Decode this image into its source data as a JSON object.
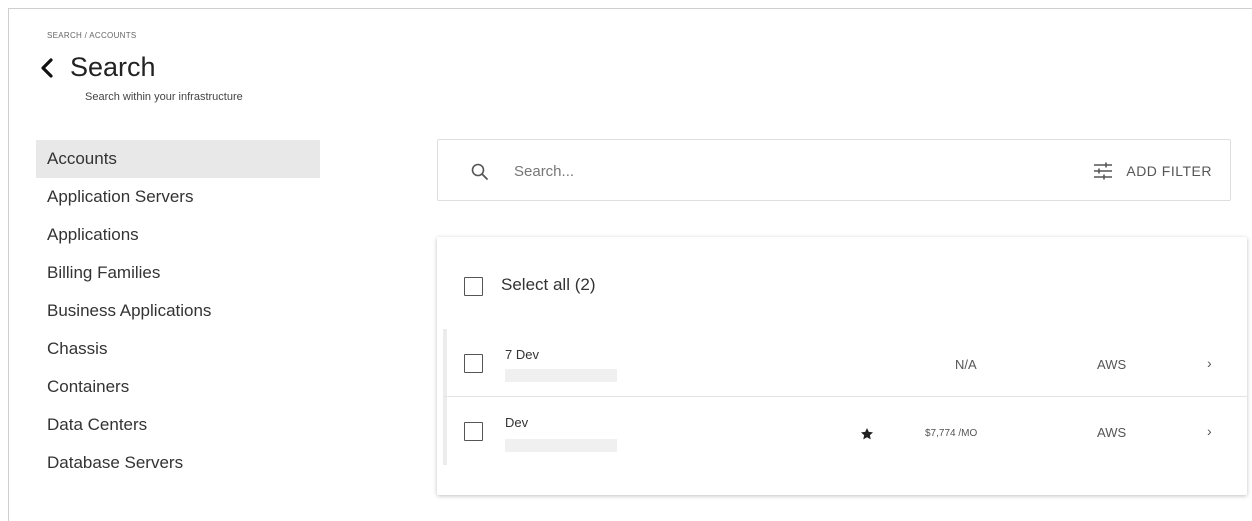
{
  "breadcrumb": "SEARCH / ACCOUNTS",
  "header": {
    "title": "Search",
    "subtitle": "Search within your infrastructure"
  },
  "sidebar": {
    "items": [
      {
        "label": "Accounts",
        "active": true
      },
      {
        "label": "Application Servers"
      },
      {
        "label": "Applications"
      },
      {
        "label": "Billing Families"
      },
      {
        "label": "Business Applications"
      },
      {
        "label": "Chassis"
      },
      {
        "label": "Containers"
      },
      {
        "label": "Data Centers"
      },
      {
        "label": "Database Servers"
      }
    ]
  },
  "search": {
    "placeholder": "Search...",
    "value": "",
    "add_filter_label": "ADD FILTER"
  },
  "results": {
    "select_all_label": "Select all (2)",
    "rows": [
      {
        "name": "7 Dev",
        "cost": "N/A",
        "provider": "AWS",
        "starred": false
      },
      {
        "name": "Dev",
        "cost": "$7,774 /MO",
        "provider": "AWS",
        "starred": true
      }
    ],
    "chevron": "›"
  },
  "icons": {
    "back": "chevron-left-icon",
    "search": "search-icon",
    "filter": "sliders-icon",
    "star": "star-icon",
    "row_chevron": "chevron-right-icon"
  },
  "colors": {
    "active_sidebar_bg": "#e8e8e8",
    "border": "#dedede",
    "text": "#333333"
  }
}
